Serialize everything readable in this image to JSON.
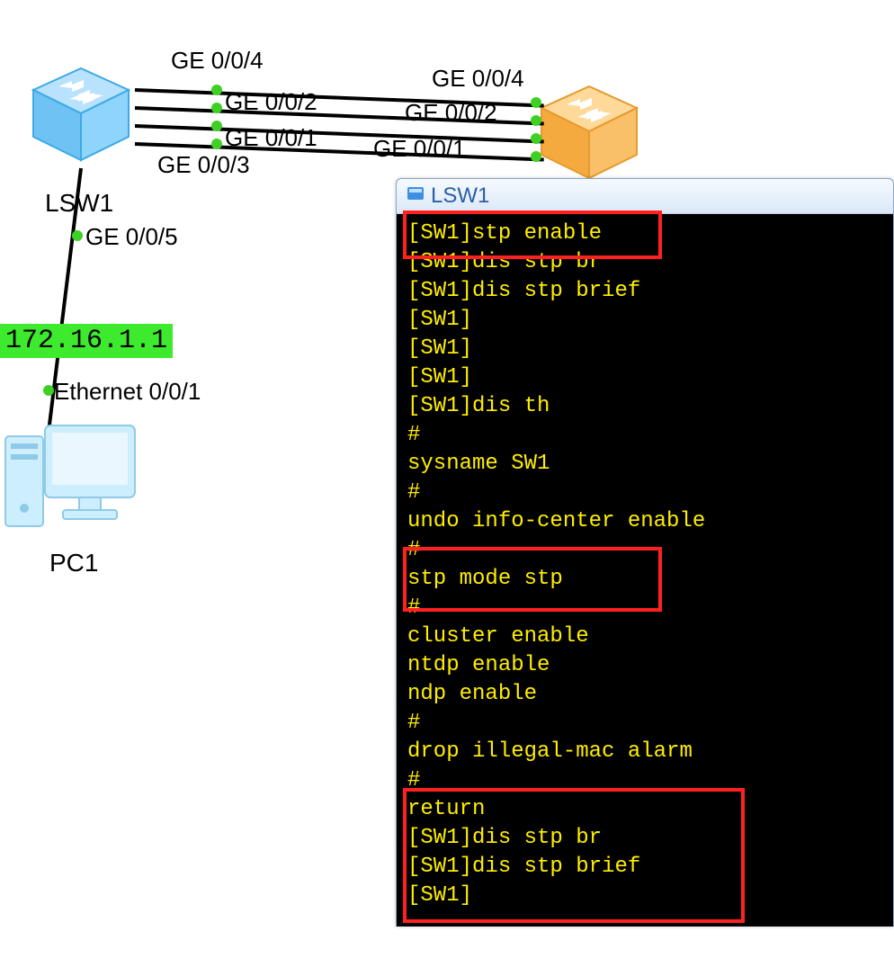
{
  "topology": {
    "devices": {
      "lsw1_left": {
        "label": "LSW1"
      },
      "lsw_right": {
        "label": ""
      },
      "pc1": {
        "label": "PC1"
      }
    },
    "interface_labels": {
      "top_left": "GE 0/0/4",
      "top_right": "GE 0/0/4",
      "mid_left_1": "GE 0/0/2",
      "mid_right_1": "GE 0/0/2",
      "mid_left_2": "GE 0/0/1",
      "mid_right_2": "GE 0/0/1",
      "bottom_left": "GE 0/0/3",
      "down_ge": "GE 0/0/5",
      "pc_eth": "Ethernet 0/0/1"
    },
    "ip_label": "172.16.1.1"
  },
  "terminal": {
    "title": "LSW1",
    "lines": [
      "[SW1]stp enable",
      "[SW1]dis stp br",
      "[SW1]dis stp brief",
      "[SW1]",
      "[SW1]",
      "[SW1]",
      "[SW1]dis th",
      "#",
      "sysname SW1",
      "#",
      "undo info-center enable",
      "#",
      "stp mode stp",
      "#",
      "cluster enable",
      "ntdp enable",
      "ndp enable",
      "#",
      "drop illegal-mac alarm",
      "#",
      "return",
      "[SW1]dis stp br",
      "[SW1]dis stp brief",
      "[SW1]"
    ]
  },
  "highlight_boxes": [
    {
      "id": "hl-stp-enable"
    },
    {
      "id": "hl-stp-mode"
    },
    {
      "id": "hl-dis-brief"
    }
  ]
}
